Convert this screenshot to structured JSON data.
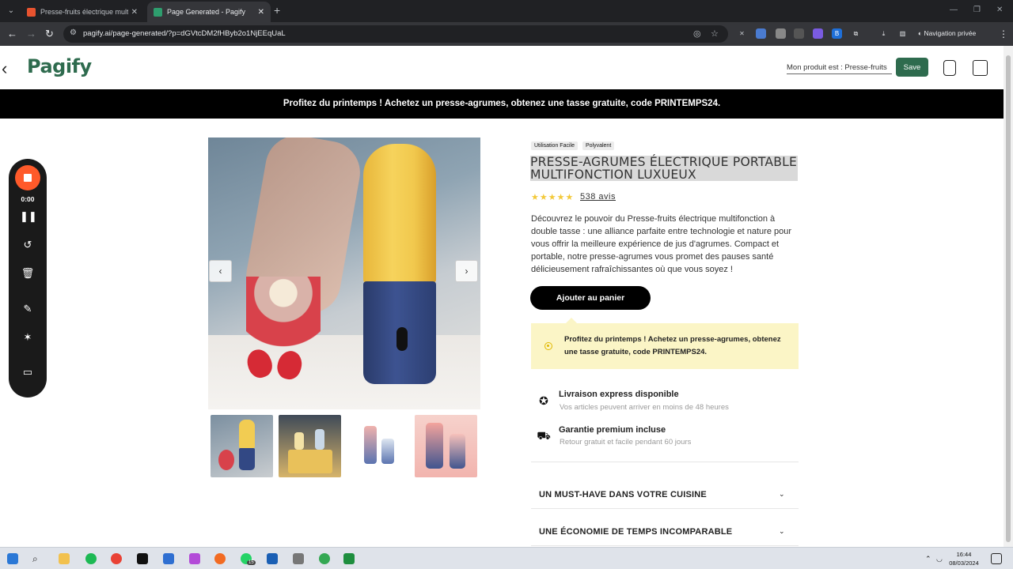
{
  "browser": {
    "tabs": [
      {
        "title": "Presse-fruits électrique multifonctio",
        "active": false
      },
      {
        "title": "Page Generated - Pagify",
        "active": true
      }
    ],
    "url": "pagify.ai/page-generated/?p=dGVtcDM2fHByb2o1NjEEqUaL",
    "incognito_label": "Navigation privée"
  },
  "header": {
    "logo": "Pagify",
    "product_input_value": "Mon produit est : Presse-fruits",
    "save_label": "Save"
  },
  "promo_banner": "Profitez du printemps ! Achetez un presse-agrumes, obtenez une tasse gratuite, code PRINTEMPS24.",
  "recorder": {
    "time": "0:00",
    "accent_color": "#ff5a2a"
  },
  "product": {
    "tags": [
      "Utilisation Facile",
      "Polyvalent"
    ],
    "title": "PRESSE-AGRUMES ÉLECTRIQUE PORTABLE MULTIFONCTION LUXUEUX",
    "rating_stars": "★★★★★",
    "rating": 5,
    "reviews": "538 avis",
    "description": "Découvrez le pouvoir du Presse-fruits électrique multifonction à double tasse : une alliance parfaite entre technologie et nature pour vous offrir la meilleure expérience de jus d'agrumes. Compact et portable, notre presse-agrumes vous promet des pauses santé délicieusement rafraîchissantes où que vous soyez !",
    "add_to_cart": "Ajouter au panier",
    "callout": "Profitez du printemps ! Achetez un presse-agrumes, obtenez une tasse gratuite, code PRINTEMPS24.",
    "features": [
      {
        "icon": "star-badge-icon",
        "title": "Livraison express disponible",
        "subtitle": "Vos articles peuvent arriver en moins de 48 heures"
      },
      {
        "icon": "delivery-truck-icon",
        "title": "Garantie premium incluse",
        "subtitle": "Retour gratuit et facile pendant 60 jours"
      }
    ],
    "accordions": [
      {
        "title": "UN MUST-HAVE DANS VOTRE CUISINE"
      },
      {
        "title": "UNE ÉCONOMIE DE TEMPS INCOMPARABLE"
      }
    ]
  },
  "taskbar": {
    "time": "16:44",
    "date": "08/03/2024",
    "badge_count": "15"
  },
  "colors": {
    "brand": "#2e6b4e",
    "callout_bg": "#fbf5c6",
    "star": "#f3c93a"
  }
}
